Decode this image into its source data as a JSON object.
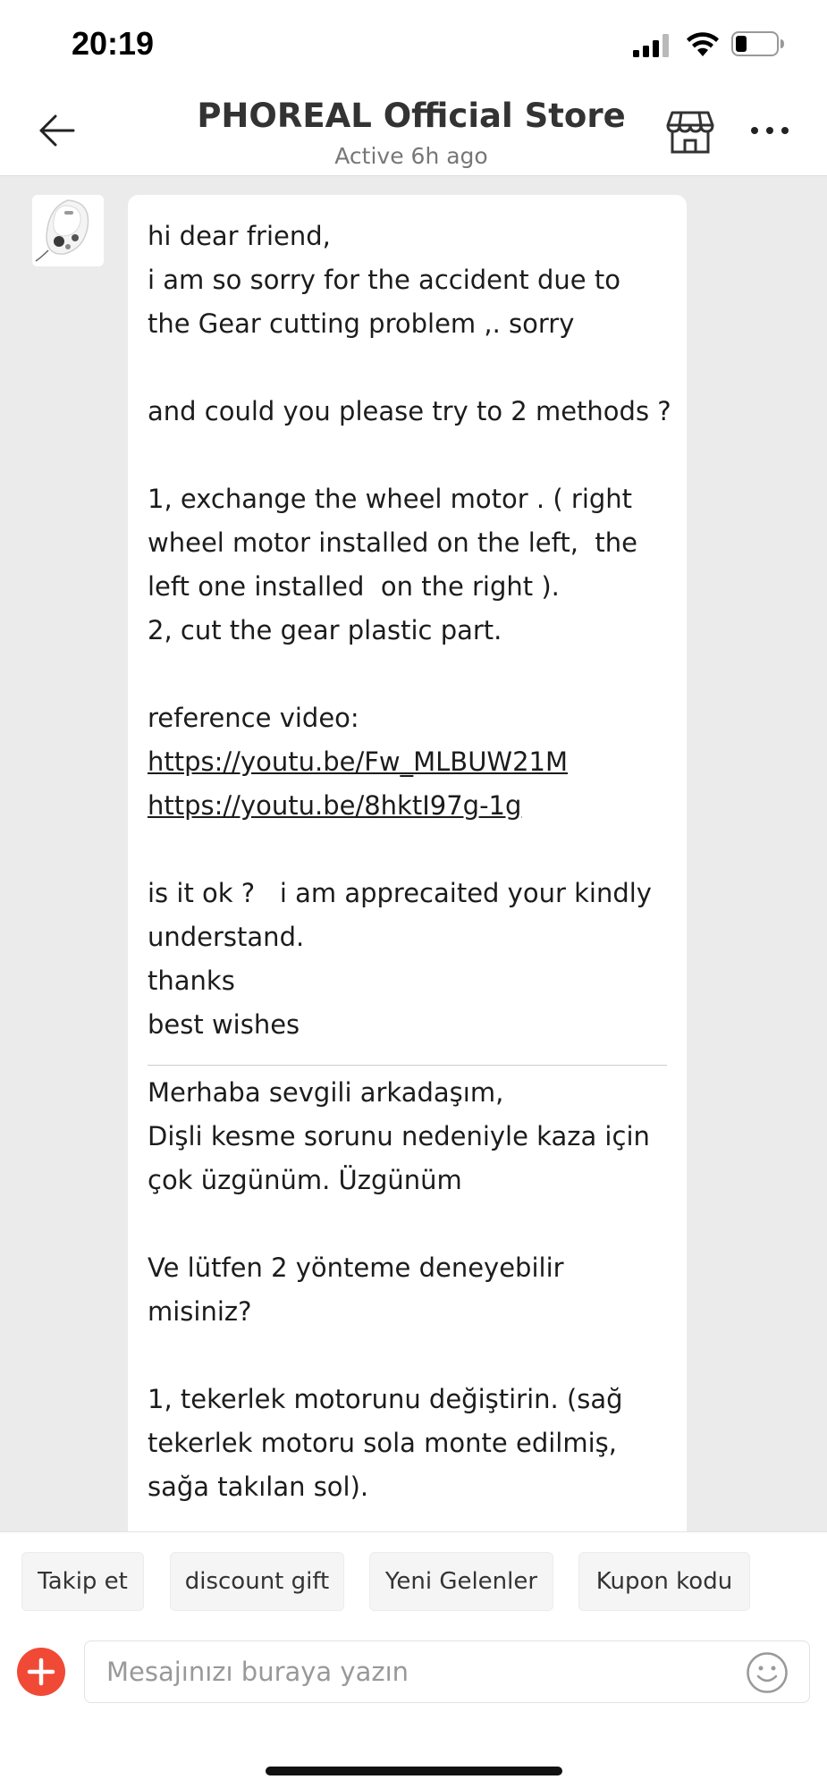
{
  "status_bar": {
    "time": "20:19"
  },
  "header": {
    "title": "PHOREAL Official Store",
    "subtitle": "Active 6h ago"
  },
  "message": {
    "english": [
      {
        "text": "hi dear friend,"
      },
      {
        "text": "i am so sorry for the accident due to"
      },
      {
        "text": "the Gear cutting problem ,. sorry"
      },
      {
        "text": ""
      },
      {
        "text": "and could you please try to 2 methods ?"
      },
      {
        "text": ""
      },
      {
        "text": "1, exchange the wheel motor . ( right"
      },
      {
        "text": "wheel motor installed on the left,  the"
      },
      {
        "text": "left one installed  on the right )."
      },
      {
        "text": "2, cut the gear plastic part."
      },
      {
        "text": ""
      },
      {
        "text": "reference video:"
      },
      {
        "text": "https://youtu.be/Fw_MLBUW21M",
        "link": true
      },
      {
        "text": "https://youtu.be/8hktI97g-1g",
        "link": true
      },
      {
        "text": ""
      },
      {
        "text": "is it ok ?   i am apprecaited your kindly"
      },
      {
        "text": "understand."
      },
      {
        "text": "thanks"
      },
      {
        "text": "best wishes"
      }
    ],
    "turkish": [
      {
        "text": "Merhaba sevgili arkadaşım,"
      },
      {
        "text": "Dişli kesme sorunu nedeniyle kaza için"
      },
      {
        "text": "çok üzgünüm. Üzgünüm"
      },
      {
        "text": ""
      },
      {
        "text": "Ve lütfen 2 yönteme deneyebilir"
      },
      {
        "text": "misiniz?"
      },
      {
        "text": ""
      },
      {
        "text": "1, tekerlek motorunu değiştirin. (sağ"
      },
      {
        "text": "tekerlek motoru sola monte edilmiş,"
      },
      {
        "text": "sağa takılan sol)."
      }
    ]
  },
  "quick_replies": [
    {
      "label": "Takip et"
    },
    {
      "label": "discount gift"
    },
    {
      "label": "Yeni Gelenler"
    },
    {
      "label": "Kupon kodu"
    }
  ],
  "input": {
    "placeholder": "Mesajınızı buraya yazın"
  },
  "colors": {
    "accent_red": "#f04a37",
    "chat_background": "#ebebeb",
    "bubble": "#ffffff"
  },
  "icons": [
    "signal-icon",
    "wifi-icon",
    "battery-icon",
    "back-arrow-icon",
    "store-icon",
    "more-icon",
    "add-icon",
    "emoji-icon"
  ]
}
